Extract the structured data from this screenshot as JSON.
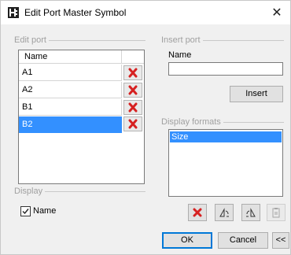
{
  "window": {
    "title": "Edit Port Master Symbol",
    "close": "✕"
  },
  "edit_port": {
    "group_label": "Edit port",
    "column_header": "Name",
    "ports": [
      "A1",
      "A2",
      "B1",
      "B2"
    ],
    "selected": "B2",
    "delete_color": "#d62121"
  },
  "insert_port": {
    "group_label": "Insert port",
    "name_label": "Name",
    "name_value": "",
    "insert_button": "Insert"
  },
  "display_formats": {
    "group_label": "Display formats",
    "items": [
      "Size"
    ],
    "selected": "Size"
  },
  "display": {
    "group_label": "Display",
    "name_checkbox_label": "Name",
    "name_checked": true
  },
  "toolbar_icons": [
    "delete-icon",
    "flip-left-icon",
    "flip-right-icon",
    "paste-icon"
  ],
  "buttons": {
    "ok": "OK",
    "cancel": "Cancel",
    "collapse": "<<"
  },
  "colors": {
    "selection": "#3390ff",
    "default_button_border": "#0078d7"
  }
}
